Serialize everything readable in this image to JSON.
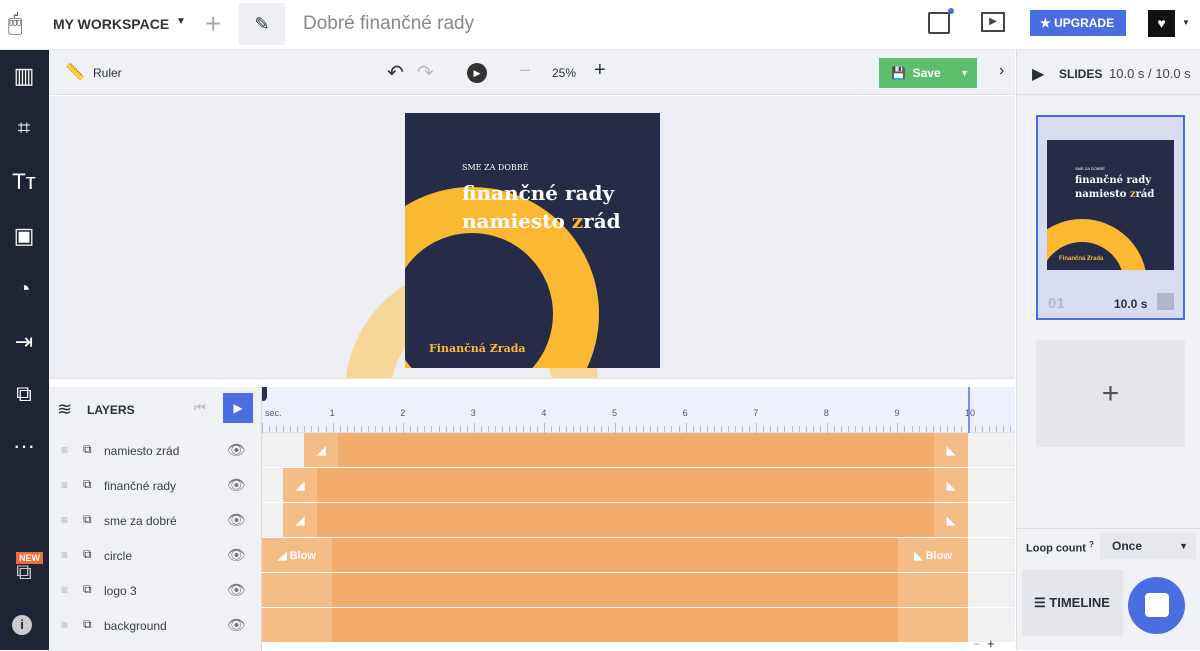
{
  "header": {
    "workspace": "MY WORKSPACE",
    "title": "Dobré finančné rady",
    "upgrade": "UPGRADE"
  },
  "toolbar": {
    "ruler": "Ruler",
    "zoom": "25%",
    "save": "Save"
  },
  "slide": {
    "kicker": "SME ZA DOBRÉ",
    "line1": "finančné rady",
    "line2_pre": "namiesto ",
    "line2_accent": "z",
    "line2_post": "rád",
    "logo": "Finančná Ƶrada"
  },
  "colors": {
    "slide_bg": "#262b47",
    "accent": "#fbb832",
    "save": "#5cbf6e",
    "upgrade": "#4a6ee0",
    "track": "#f2ad6c",
    "sidebar": "#1f2336"
  },
  "layers": {
    "title": "LAYERS",
    "items": [
      {
        "name": "namiesto zrád",
        "start": 0.6,
        "end": 10,
        "in": "◢",
        "out": "◣"
      },
      {
        "name": "finančné rady",
        "start": 0.3,
        "end": 10,
        "in": "◢",
        "out": "◣"
      },
      {
        "name": "sme za dobré",
        "start": 0.3,
        "end": 10,
        "in": "◢",
        "out": "◣"
      },
      {
        "name": "circle",
        "start": 0,
        "end": 10,
        "in": "◢ Blow",
        "out": "◣ Blow"
      },
      {
        "name": "logo 3",
        "start": 0,
        "end": 10,
        "in": "",
        "out": ""
      },
      {
        "name": "background",
        "start": 0,
        "end": 10,
        "in": "",
        "out": ""
      }
    ]
  },
  "ruler": {
    "unit": "sec.",
    "ticks": [
      "1",
      "2",
      "3",
      "4",
      "5",
      "6",
      "7",
      "8",
      "9",
      "10"
    ],
    "duration": 10
  },
  "sidebar": {
    "new_badge": "NEW"
  },
  "slides": {
    "title": "SLIDES",
    "duration": "10.0 s / 10.0 s",
    "items": [
      {
        "number": "01",
        "duration": "10.0 s"
      }
    ],
    "add": "+"
  },
  "loop": {
    "label": "Loop count",
    "help": "?",
    "value": "Once"
  },
  "timeline_button": "TIMELINE"
}
